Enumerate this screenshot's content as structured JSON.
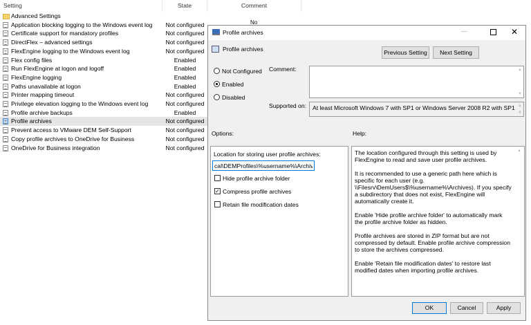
{
  "list": {
    "columns": [
      "Setting",
      "State",
      "Comment"
    ],
    "peek_text": "No",
    "rows": [
      {
        "name": "Advanced Settings",
        "state": "",
        "icon": "folder-icon"
      },
      {
        "name": "Application blocking logging to the Windows event log",
        "state": "Not configured",
        "icon": "setting-icon"
      },
      {
        "name": "Certificate support for mandatory profiles",
        "state": "Not configured",
        "icon": "setting-icon"
      },
      {
        "name": "DirectFlex – advanced settings",
        "state": "Not configured",
        "icon": "setting-icon"
      },
      {
        "name": "FlexEngine logging to the Windows event log",
        "state": "Not configured",
        "icon": "setting-icon"
      },
      {
        "name": "Flex config files",
        "state": "Enabled",
        "icon": "setting-icon"
      },
      {
        "name": "Run FlexEngine at logon and logoff",
        "state": "Enabled",
        "icon": "setting-icon"
      },
      {
        "name": "FlexEngine logging",
        "state": "Enabled",
        "icon": "setting-icon"
      },
      {
        "name": "Paths unavailable at logon",
        "state": "Enabled",
        "icon": "setting-icon"
      },
      {
        "name": "Printer mapping timeout",
        "state": "Not configured",
        "icon": "setting-icon"
      },
      {
        "name": "Privilege elevation logging to the Windows event log",
        "state": "Not configured",
        "icon": "setting-icon"
      },
      {
        "name": "Profile archive backups",
        "state": "Enabled",
        "icon": "setting-icon"
      },
      {
        "name": "Profile archives",
        "state": "Not configured",
        "icon": "setting-icon",
        "selected": true
      },
      {
        "name": "Prevent access to VMware DEM Self-Support",
        "state": "Not configured",
        "icon": "setting-icon"
      },
      {
        "name": "Copy profile archives to OneDrive for Business",
        "state": "Not configured",
        "icon": "setting-icon"
      },
      {
        "name": "OneDrive for Business integration",
        "state": "Not configured",
        "icon": "setting-icon"
      }
    ]
  },
  "dialog": {
    "title": "Profile archives",
    "setting_name": "Profile archives",
    "prev_label": "Previous Setting",
    "next_label": "Next Setting",
    "radios": [
      {
        "label": "Not Configured",
        "checked": false
      },
      {
        "label": "Enabled",
        "checked": true
      },
      {
        "label": "Disabled",
        "checked": false
      }
    ],
    "comment_label": "Comment:",
    "comment_value": "",
    "supported_label": "Supported on:",
    "supported_value": "At least Microsoft Windows 7 with SP1 or Windows Server 2008 R2 with SP1",
    "options_label": "Options:",
    "help_label": "Help:",
    "location_label": "Location for storing user profile archives:",
    "location_value": "cal\\DEMProfiles\\%username%\\Archives",
    "checkboxes": [
      {
        "label": "Hide profile archive folder",
        "checked": false
      },
      {
        "label": "Compress profile archives",
        "checked": true
      },
      {
        "label": "Retain file modification dates",
        "checked": false
      }
    ],
    "help_paragraphs": [
      "The location configured through this setting is used by FlexEngine to read and save user profile archives.",
      "It is recommended to use a generic path here which is specific for each user (e.g. \\\\Filesrv\\DemUsers$\\%username%\\Archives). If you specify a subdirectory that does not exist, FlexEngine will automatically create it.",
      "Enable 'Hide profile archive folder' to automatically mark the profile archive folder as hidden.",
      "Profile archives are stored in ZIP format but are not compressed by default. Enable profile archive compression to store the archives compressed.",
      "Enable 'Retain file modification dates' to restore last modified dates when importing profile archives."
    ],
    "ok_label": "OK",
    "cancel_label": "Cancel",
    "apply_label": "Apply",
    "accent": "#0078d7"
  }
}
